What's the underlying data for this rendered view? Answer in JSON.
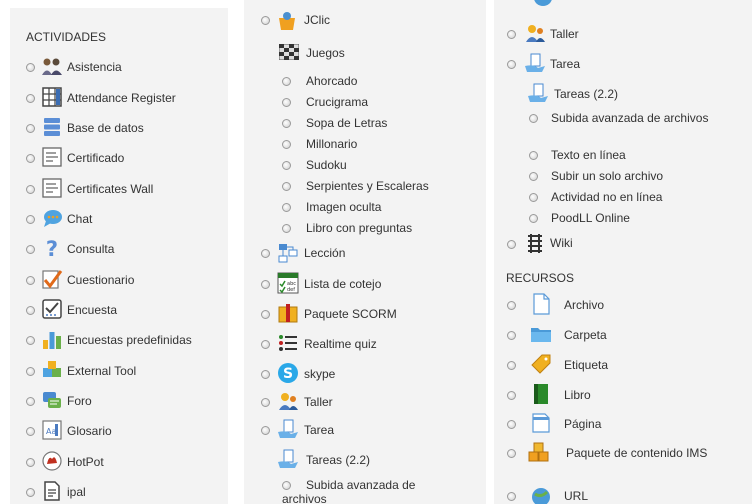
{
  "col1": {
    "header": "ACTIVIDADES",
    "items": [
      "Asistencia",
      "Attendance Register",
      "Base de datos",
      "Certificado",
      "Certificates Wall",
      "Chat",
      "Consulta",
      "Cuestionario",
      "Encuesta",
      "Encuestas predefinidas",
      "External Tool",
      "Foro",
      "Glosario",
      "HotPot",
      "ipal"
    ]
  },
  "col2": {
    "jclic": "JClic",
    "juegos": "Juegos",
    "games": [
      "Ahorcado",
      "Crucigrama",
      "Sopa de Letras",
      "Millonario",
      "Sudoku",
      "Serpientes y Escaleras",
      "Imagen oculta",
      "Libro con preguntas"
    ],
    "items": [
      "Lección",
      "Lista de cotejo",
      "Paquete SCORM",
      "Realtime quiz",
      "skype",
      "Taller",
      "Tarea"
    ],
    "tareas": "Tareas (2.2)",
    "subida": "Subida avanzada de archivos"
  },
  "col3": {
    "top_items": [
      "Taller",
      "Tarea"
    ],
    "tareas": "Tareas (2.2)",
    "subida": "Subida avanzada de archivos",
    "sub_items": [
      "Texto en línea",
      "Subir un solo archivo",
      "Actividad no en línea",
      "PoodLL Online"
    ],
    "wiki": "Wiki",
    "recursos_header": "RECURSOS",
    "recursos": [
      "Archivo",
      "Carpeta",
      "Etiqueta",
      "Libro",
      "Página"
    ],
    "paquete": "Paquete de contenido IMS",
    "url": "URL"
  }
}
